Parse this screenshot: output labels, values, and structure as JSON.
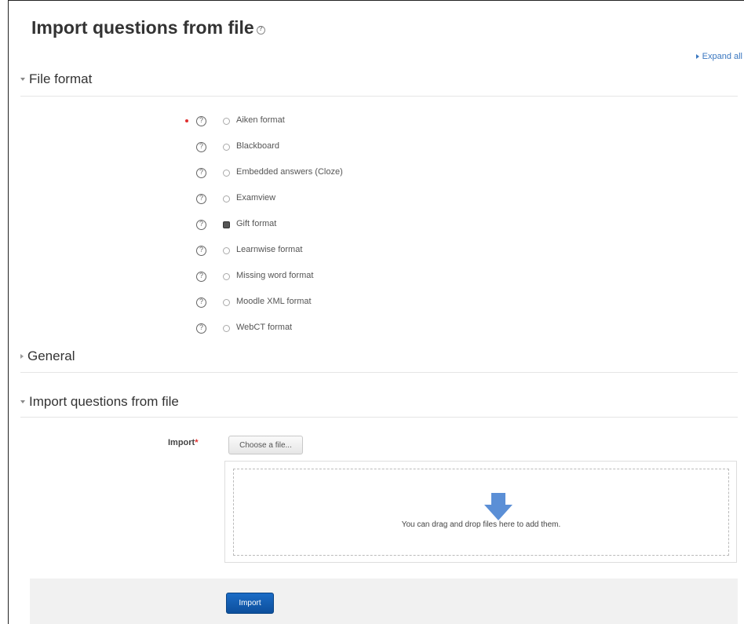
{
  "page": {
    "title": "Import questions from file"
  },
  "expand_all": "Expand all",
  "sections": {
    "file_format": "File format",
    "general": "General",
    "import_questions": "Import questions from file"
  },
  "formats": [
    {
      "label": "Aiken format",
      "selected": false,
      "required": true
    },
    {
      "label": "Blackboard",
      "selected": false,
      "required": false
    },
    {
      "label": "Embedded answers (Cloze)",
      "selected": false,
      "required": false
    },
    {
      "label": "Examview",
      "selected": false,
      "required": false
    },
    {
      "label": "Gift format",
      "selected": true,
      "required": false
    },
    {
      "label": "Learnwise format",
      "selected": false,
      "required": false
    },
    {
      "label": "Missing word format",
      "selected": false,
      "required": false
    },
    {
      "label": "Moodle XML format",
      "selected": false,
      "required": false
    },
    {
      "label": "WebCT format",
      "selected": false,
      "required": false
    }
  ],
  "import_field": {
    "label": "Import",
    "required_mark": "*",
    "choose_button": "Choose a file...",
    "drop_text": "You can drag and drop files here to add them."
  },
  "submit_button": "Import",
  "colors": {
    "accent": "#0d4f9c",
    "link": "#3a77c0",
    "required": "#e03030",
    "arrow": "#5b8fd6"
  }
}
